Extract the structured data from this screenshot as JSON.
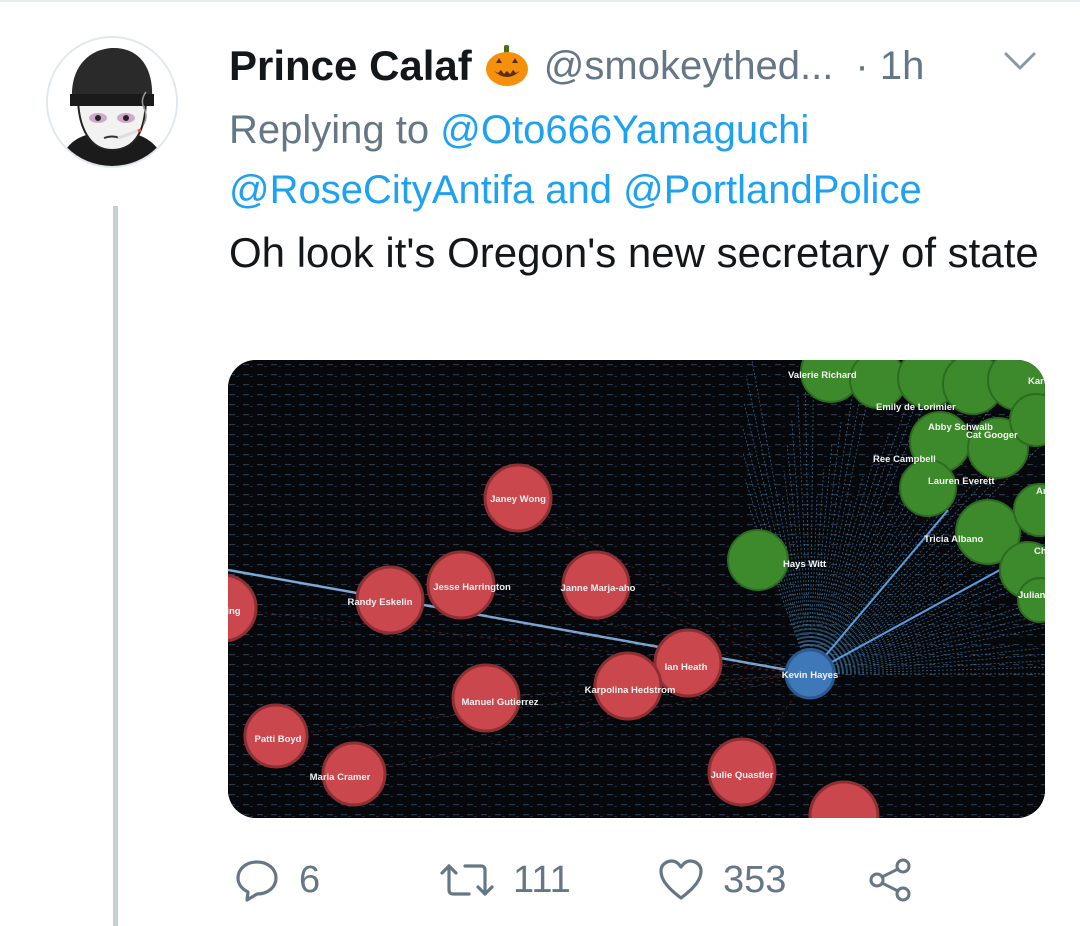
{
  "tweet": {
    "display_name": "Prince Calaf",
    "emoji_icon": "jack-o-lantern-icon",
    "handle": "@smokeythed...",
    "separator_time": "· 1h",
    "reply_prefix": "Replying to",
    "reply_mention_1": "@Oto666Yamaguchi",
    "reply_mention_2": "@RoseCityAntifa",
    "reply_and": "and",
    "reply_mention_3": "@PortlandPolice",
    "text": "Oh look it's Oregon's new secretary of state"
  },
  "graph": {
    "red_nodes": [
      {
        "label": "Janey Wong"
      },
      {
        "label": "Jesse Harrington"
      },
      {
        "label": "Randy Eskelin"
      },
      {
        "label": "Janne Marja-aho"
      },
      {
        "label": "King"
      },
      {
        "label": "Ian Heath"
      },
      {
        "label": "Karpolina Hedstrom"
      },
      {
        "label": "Manuel Gutierrez"
      },
      {
        "label": "Patti Boyd"
      },
      {
        "label": "Maria Cramer"
      },
      {
        "label": "Julie Quastler"
      }
    ],
    "blue_node": {
      "label": "Kevin Hayes"
    },
    "green_nodes": [
      {
        "label": "Hays Witt"
      },
      {
        "label": "Valerie Richard"
      },
      {
        "label": "Emily de Lorimier"
      },
      {
        "label": "Abby Schwalb"
      },
      {
        "label": "Cat Googer"
      },
      {
        "label": "Ree Campbell"
      },
      {
        "label": "Lauren Everett"
      },
      {
        "label": "Tricia Albano"
      },
      {
        "label": "Julian"
      },
      {
        "label": "Karen"
      },
      {
        "label": "Amy"
      },
      {
        "label": "Chris"
      }
    ],
    "colors": {
      "red": "#c9474d",
      "green": "#3c8a2c",
      "blue": "#3f78b8",
      "edge_red": "#a8454a",
      "edge_blue": "#5aa8e6"
    }
  },
  "actions": {
    "reply_count": "6",
    "retweet_count": "111",
    "like_count": "353",
    "share_icon": "share-icon"
  }
}
